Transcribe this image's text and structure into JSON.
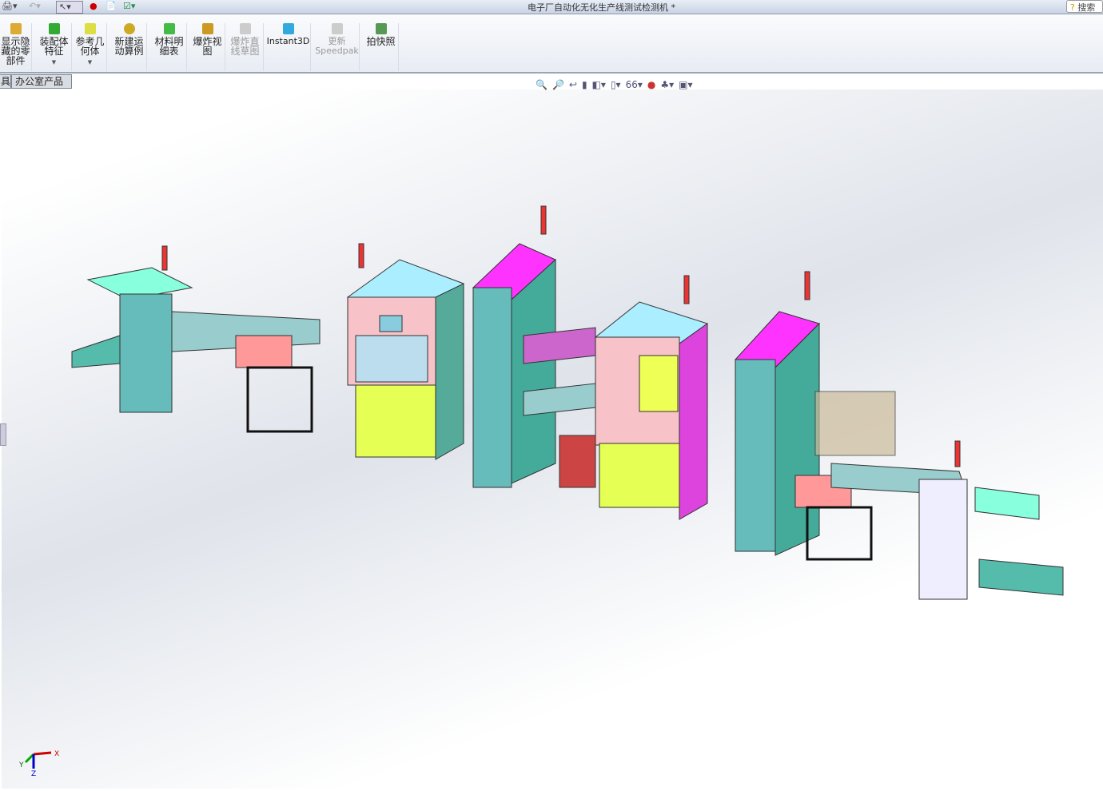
{
  "window": {
    "title": "电子厂自动化无化生产线测试检测机 *",
    "search_label": "搜索"
  },
  "quick_access": [
    "print-icon",
    "undo-icon",
    "select-icon",
    "rebuild-icon",
    "file-properties-icon",
    "options-icon"
  ],
  "ribbon": {
    "items": [
      {
        "label": "显示隐藏的零部件",
        "icon": "show-hidden-components-icon",
        "enabled": true
      },
      {
        "label": "装配体特征",
        "icon": "assembly-features-icon",
        "enabled": true,
        "dropdown": true
      },
      {
        "label": "参考几何体",
        "icon": "reference-geometry-icon",
        "enabled": true,
        "dropdown": true
      },
      {
        "label": "新建运动算例",
        "icon": "new-motion-study-icon",
        "enabled": true
      },
      {
        "label": "材料明细表",
        "icon": "bill-of-materials-icon",
        "enabled": true
      },
      {
        "label": "爆炸视图",
        "icon": "exploded-view-icon",
        "enabled": true
      },
      {
        "label": "爆炸直线草图",
        "icon": "explode-line-sketch-icon",
        "enabled": false
      },
      {
        "label": "Instant3D",
        "icon": "instant3d-icon",
        "enabled": true
      },
      {
        "label": "更新Speedpak",
        "icon": "update-speedpak-icon",
        "enabled": false
      },
      {
        "label": "拍快照",
        "icon": "take-snapshot-icon",
        "enabled": true
      }
    ]
  },
  "tabs": [
    {
      "label": "具"
    },
    {
      "label": "办公室产品"
    }
  ],
  "view_toolbar": [
    "zoom-to-fit-icon",
    "zoom-to-area-icon",
    "previous-view-icon",
    "section-view-icon",
    "view-orientation-icon",
    "display-style-icon",
    "hide-show-items-icon",
    "edit-appearance-icon",
    "apply-scene-icon",
    "view-settings-icon"
  ],
  "triad": {
    "x": "X",
    "y": "Y",
    "z": "Z"
  },
  "colors": {
    "magenta": "#ff33ff",
    "teal": "#5fb3b3",
    "yellow": "#e5ff55",
    "pink": "#f0a0a8"
  }
}
